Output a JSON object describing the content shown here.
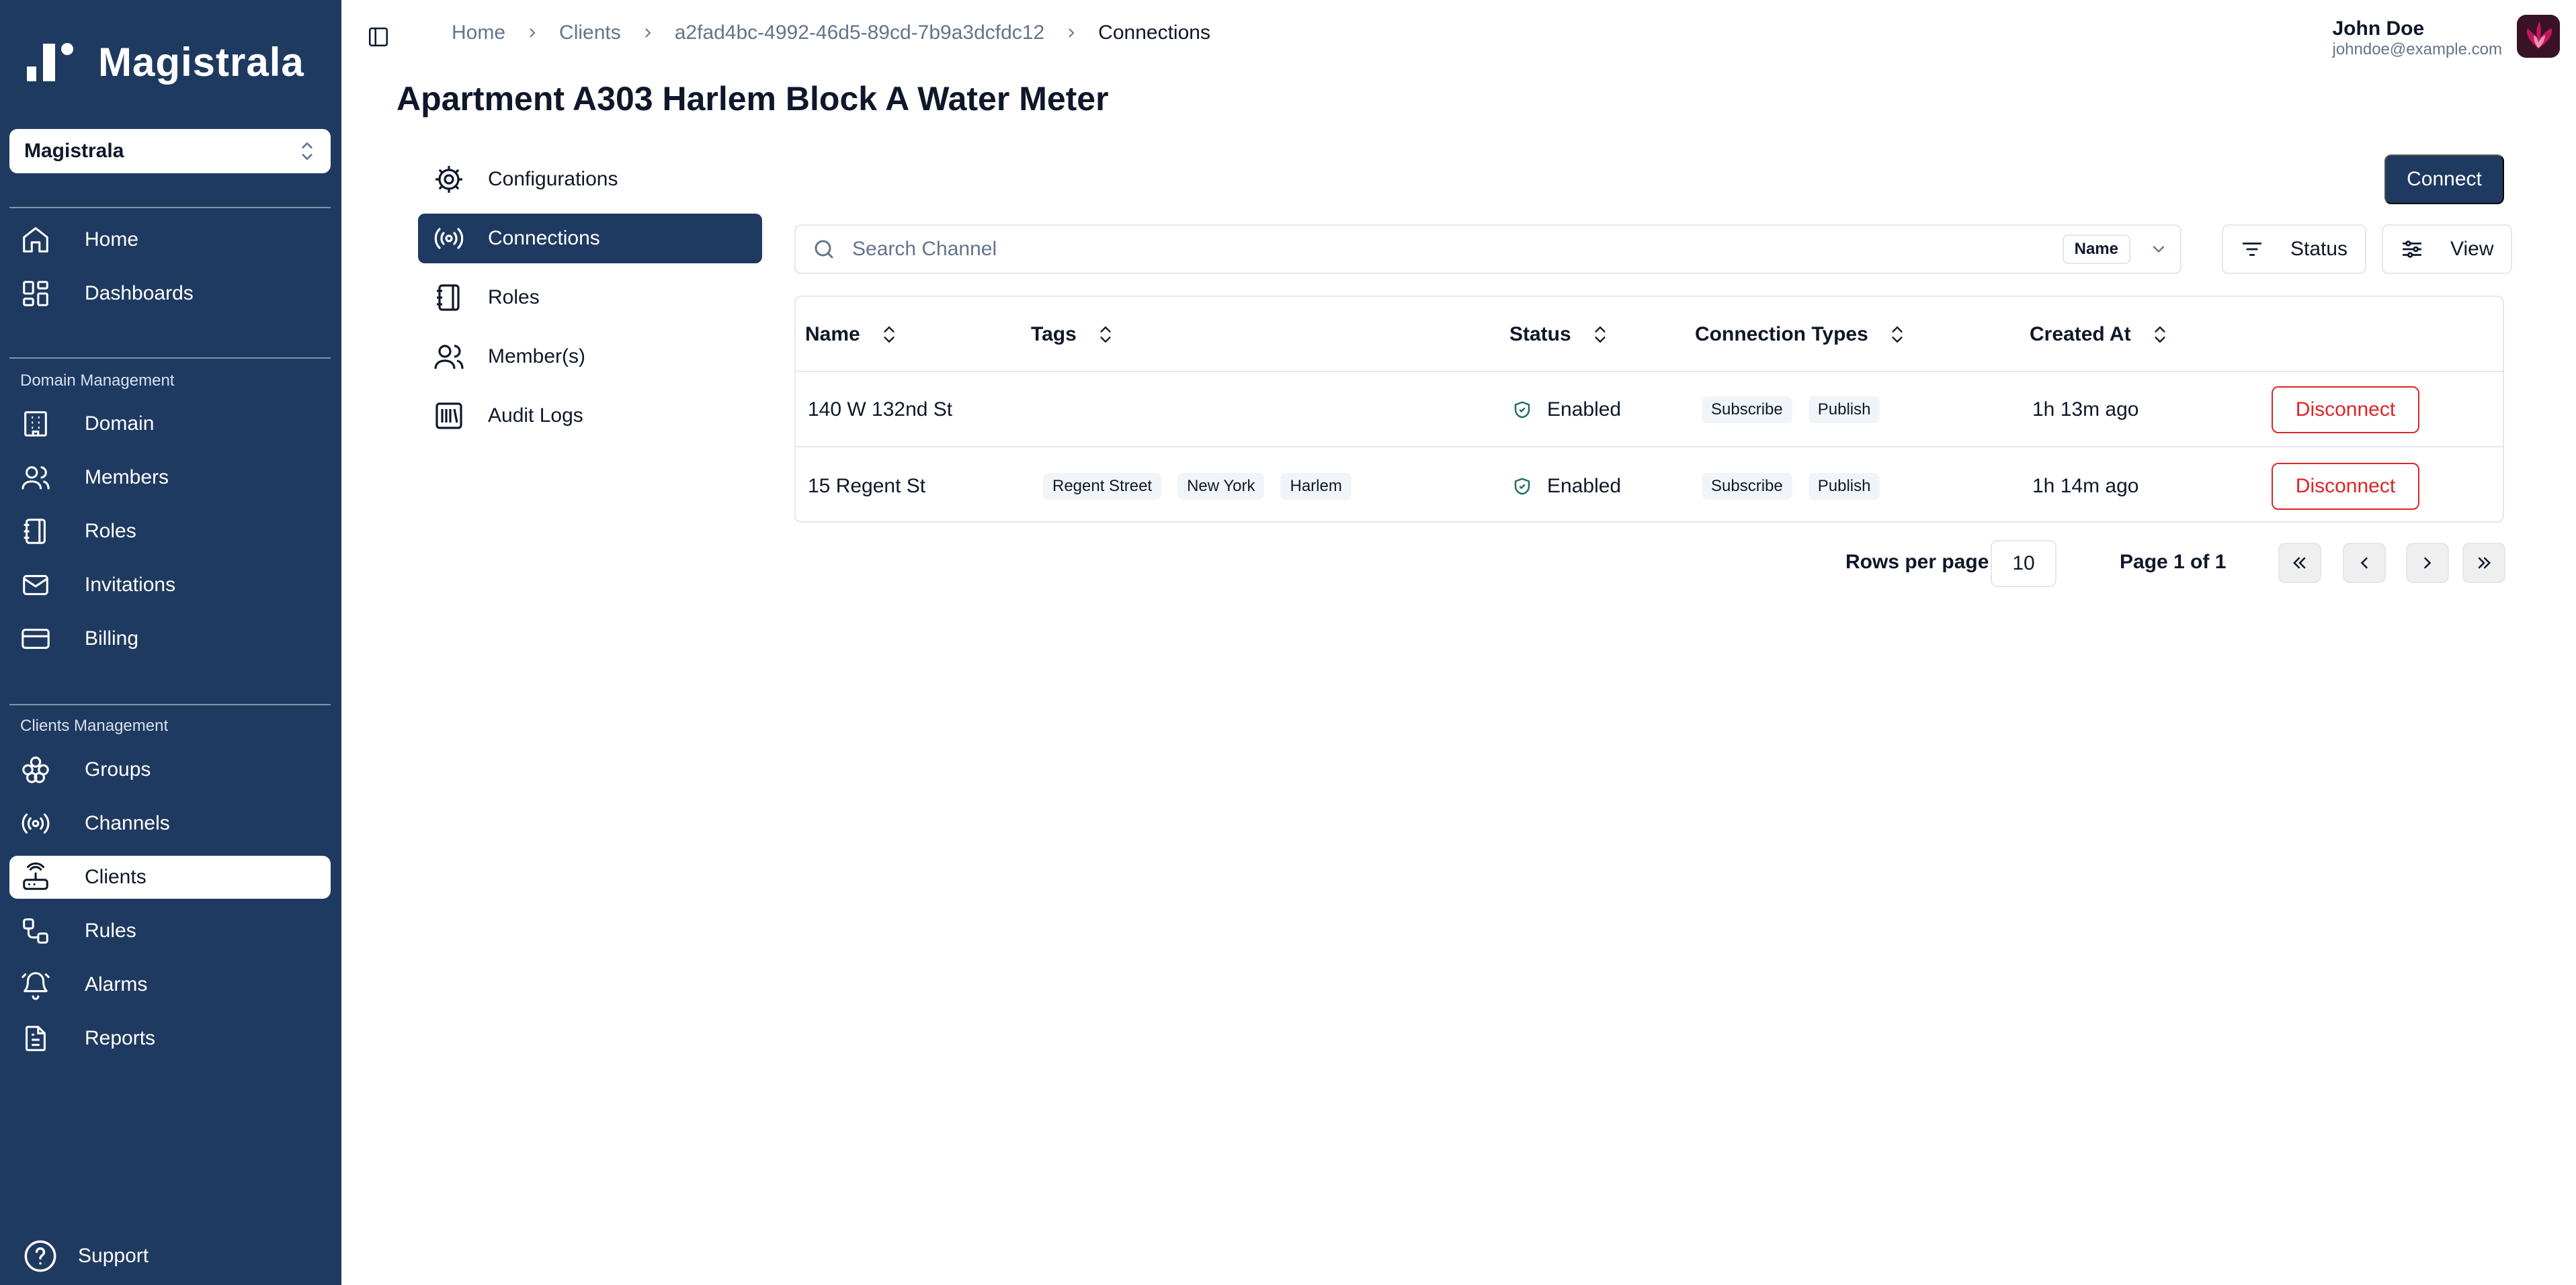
{
  "sidebar": {
    "brand": "Magistrala",
    "domain_select": "Magistrala",
    "main_items": [
      {
        "label": "Home",
        "icon": "home-icon"
      },
      {
        "label": "Dashboards",
        "icon": "dashboard-icon"
      }
    ],
    "domain_section": {
      "label": "Domain Management",
      "items": [
        {
          "label": "Domain",
          "icon": "building-icon"
        },
        {
          "label": "Members",
          "icon": "users-icon"
        },
        {
          "label": "Roles",
          "icon": "notebook-icon"
        },
        {
          "label": "Invitations",
          "icon": "mail-icon"
        },
        {
          "label": "Billing",
          "icon": "credit-card-icon"
        }
      ]
    },
    "clients_section": {
      "label": "Clients Management",
      "items": [
        {
          "label": "Groups",
          "icon": "groups-icon"
        },
        {
          "label": "Channels",
          "icon": "radio-icon"
        },
        {
          "label": "Clients",
          "icon": "router-icon",
          "active": true
        },
        {
          "label": "Rules",
          "icon": "workflow-icon"
        },
        {
          "label": "Alarms",
          "icon": "bell-icon"
        },
        {
          "label": "Reports",
          "icon": "file-icon"
        }
      ]
    },
    "support": "Support"
  },
  "header": {
    "breadcrumb": [
      "Home",
      "Clients",
      "a2fad4bc-4992-46d5-89cd-7b9a3dcfdc12",
      "Connections"
    ],
    "user": {
      "name": "John Doe",
      "email": "johndoe@example.com"
    }
  },
  "page": {
    "title": "Apartment A303 Harlem Block A Water Meter"
  },
  "subnav": [
    {
      "label": "Configurations",
      "icon": "settings-icon"
    },
    {
      "label": "Connections",
      "icon": "radio-icon",
      "active": true
    },
    {
      "label": "Roles",
      "icon": "notebook-icon"
    },
    {
      "label": "Member(s)",
      "icon": "users-icon"
    },
    {
      "label": "Audit Logs",
      "icon": "library-icon"
    }
  ],
  "toolbar": {
    "connect_label": "Connect",
    "search_placeholder": "Search Channel",
    "search_filter": "Name",
    "status_label": "Status",
    "view_label": "View"
  },
  "table": {
    "columns": [
      "Name",
      "Tags",
      "Status",
      "Connection Types",
      "Created At"
    ],
    "rows": [
      {
        "name": "140 W 132nd St",
        "tags": [],
        "status": "Enabled",
        "connection_types": [
          "Subscribe",
          "Publish"
        ],
        "created_at": "1h 13m ago",
        "action": "Disconnect"
      },
      {
        "name": "15 Regent St",
        "tags": [
          "Regent Street",
          "New York",
          "Harlem"
        ],
        "status": "Enabled",
        "connection_types": [
          "Subscribe",
          "Publish"
        ],
        "created_at": "1h 14m ago",
        "action": "Disconnect"
      }
    ]
  },
  "pagination": {
    "rows_per_page_label": "Rows per page",
    "rows_per_page": "10",
    "page_label": "Page 1 of 1"
  },
  "colors": {
    "sidebar_bg": "#1f3a60",
    "primary": "#1f3a60",
    "danger": "#dc2626",
    "border": "#e2e8f0",
    "muted_text": "#64748b"
  }
}
